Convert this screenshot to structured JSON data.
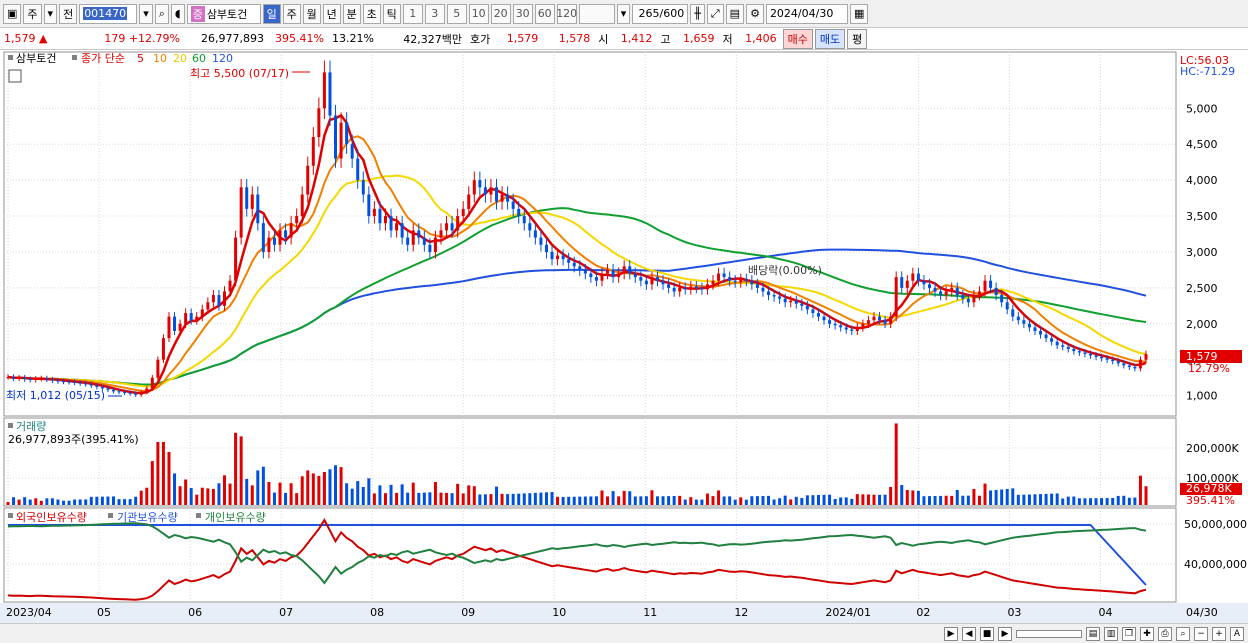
{
  "toolbar": {
    "market": "주",
    "prev_label": "전",
    "code": "001470",
    "stock_name": "삼부토건",
    "stock_badge": "증",
    "periods": [
      "일",
      "주",
      "월",
      "년",
      "분",
      "초",
      "틱"
    ],
    "active_period": "일",
    "intervals": [
      "1",
      "3",
      "5",
      "10",
      "20",
      "30",
      "60",
      "120"
    ],
    "count": "265",
    "count_max": "/600",
    "date": "2024/04/30"
  },
  "infobar": {
    "price": "1,579",
    "arrow": "▲",
    "change": "179",
    "change_pct": "+12.79%",
    "volume": "26,977,893",
    "volume_ratio": "395.41%",
    "turnover": "13.21%",
    "amount": "42,327백만",
    "quote_label": "호가",
    "ask": "1,579",
    "bid": "1,578",
    "open_label": "시",
    "open": "1,412",
    "high_label": "고",
    "high": "1,659",
    "low_label": "저",
    "low": "1,406",
    "buy_label": "매수",
    "sell_label": "매도",
    "eval_label": "평"
  },
  "colors": {
    "up": "#e00000",
    "down": "#0050e0",
    "ma5": "#e00000",
    "ma10": "#f08000",
    "ma20": "#f5d800",
    "ma60": "#10a030",
    "ma120": "#2050e0",
    "foreign": "#d00000",
    "inst": "#2050e0",
    "retail": "#208040"
  },
  "chart_data": [
    {
      "type": "candlestick",
      "panel": "price",
      "legend": {
        "name": "삼부토건",
        "label": "종가 단순",
        "periods": [
          "5",
          "10",
          "20",
          "60",
          "120"
        ]
      },
      "y_ticks": [
        "5,000",
        "4,500",
        "4,000",
        "3,500",
        "3,000",
        "2,500",
        "2,000",
        "1,500",
        "1,000"
      ],
      "ylim": [
        800,
        5700
      ],
      "x_ticks": [
        "2023/04",
        "05",
        "06",
        "07",
        "08",
        "09",
        "10",
        "11",
        "12",
        "2024/01",
        "02",
        "03",
        "04"
      ],
      "x_end_label": "04/30",
      "lc_label": "LC:56.03",
      "hc_label": "HC:-71.29",
      "last_price_label": "1,579",
      "last_change_label": "12.79%",
      "high_annotation": "최고 5,500 (07/17)",
      "low_annotation": "최저 1,012 (05/15)",
      "dividend_annotation": "배당락(0.00%)",
      "closes": [
        1260,
        1240,
        1250,
        1230,
        1220,
        1235,
        1240,
        1225,
        1210,
        1200,
        1195,
        1190,
        1180,
        1170,
        1160,
        1140,
        1120,
        1100,
        1080,
        1060,
        1050,
        1040,
        1030,
        1012,
        1050,
        1100,
        1250,
        1500,
        1800,
        2100,
        1900,
        2000,
        2150,
        2050,
        2100,
        2200,
        2300,
        2400,
        2250,
        2450,
        2600,
        3200,
        3900,
        3600,
        3800,
        3400,
        3000,
        3200,
        3100,
        3300,
        3200,
        3400,
        3500,
        3800,
        4200,
        4600,
        5000,
        5500,
        4900,
        4300,
        4800,
        4500,
        4300,
        4000,
        3800,
        3500,
        3600,
        3400,
        3500,
        3300,
        3400,
        3200,
        3100,
        3300,
        3200,
        3100,
        3000,
        3200,
        3300,
        3400,
        3300,
        3500,
        3600,
        3800,
        4000,
        3900,
        3800,
        3900,
        3700,
        3800,
        3700,
        3600,
        3500,
        3400,
        3300,
        3200,
        3100,
        3000,
        2900,
        2950,
        2900,
        2850,
        2800,
        2750,
        2700,
        2650,
        2600,
        2700,
        2750,
        2650,
        2700,
        2800,
        2700,
        2650,
        2600,
        2550,
        2650,
        2600,
        2550,
        2500,
        2450,
        2500,
        2480,
        2520,
        2500,
        2480,
        2550,
        2600,
        2700,
        2650,
        2600,
        2580,
        2620,
        2600,
        2550,
        2500,
        2450,
        2400,
        2380,
        2350,
        2300,
        2320,
        2280,
        2250,
        2200,
        2150,
        2100,
        2050,
        2000,
        1980,
        1950,
        1920,
        1900,
        1950,
        2000,
        2050,
        2100,
        2050,
        2000,
        2100,
        2650,
        2500,
        2600,
        2700,
        2600,
        2550,
        2500,
        2450,
        2400,
        2450,
        2500,
        2400,
        2350,
        2300,
        2400,
        2450,
        2600,
        2500,
        2400,
        2300,
        2200,
        2100,
        2050,
        2000,
        1950,
        1900,
        1850,
        1800,
        1750,
        1700,
        1680,
        1650,
        1620,
        1600,
        1580,
        1560,
        1540,
        1520,
        1500,
        1480,
        1450,
        1420,
        1400,
        1379,
        1500,
        1579
      ],
      "volume_panel": {
        "title": "거래량",
        "current_label": "26,977,893주(395.41%)",
        "y_ticks": [
          "200,000K",
          "100,000K"
        ],
        "last_label": "26,978K",
        "last_pct_label": "395.41%"
      }
    },
    {
      "type": "line",
      "panel": "holdings",
      "legend": [
        "외국인보유수량",
        "기관보유수량",
        "개인보유수량"
      ],
      "y_ticks": [
        "50,000,000",
        "40,000,000"
      ]
    }
  ]
}
